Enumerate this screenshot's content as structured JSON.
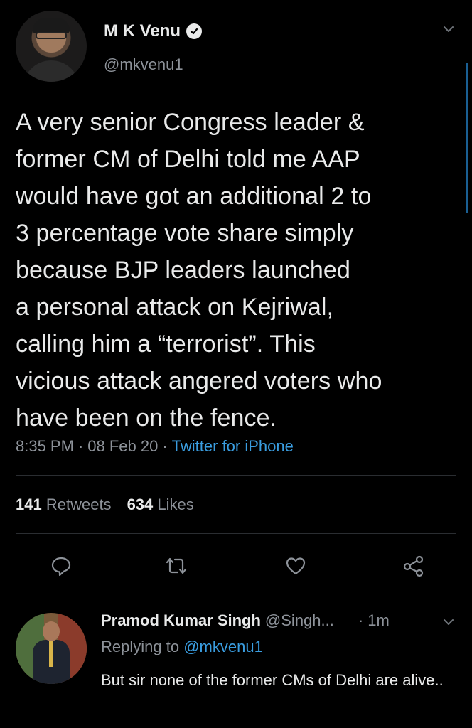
{
  "tweet": {
    "author_name": "M K Venu",
    "author_handle": "@mkvenu1",
    "body": "A very senior Congress leader &\nformer CM of Delhi told me AAP\nwould have got an additional 2 to\n3 percentage vote share simply\nbecause BJP leaders launched\na personal attack on Kejriwal,\ncalling him a “terrorist”. This\nvicious attack angered voters who\nhave been on the fence.",
    "time": "8:35 PM",
    "date": "08 Feb 20",
    "source": "Twitter for iPhone",
    "separator": "·",
    "retweets_count": "141",
    "retweets_label": "Retweets",
    "likes_count": "634",
    "likes_label": "Likes"
  },
  "actions": [
    "reply-icon",
    "retweet-icon",
    "like-icon",
    "share-icon"
  ],
  "reply": {
    "author_name": "Pramod Kumar Singh",
    "author_handle": "@Singh...",
    "time": "· 1m",
    "replying_prefix": "Replying to",
    "replying_to": "@mkvenu1",
    "body": "But sir none of the former CMs of Delhi are alive.."
  },
  "colors": {
    "background": "#000000",
    "text": "#e9eaea",
    "secondary": "#8d9299",
    "link": "#3a9de0",
    "divider": "#2a2d31"
  }
}
